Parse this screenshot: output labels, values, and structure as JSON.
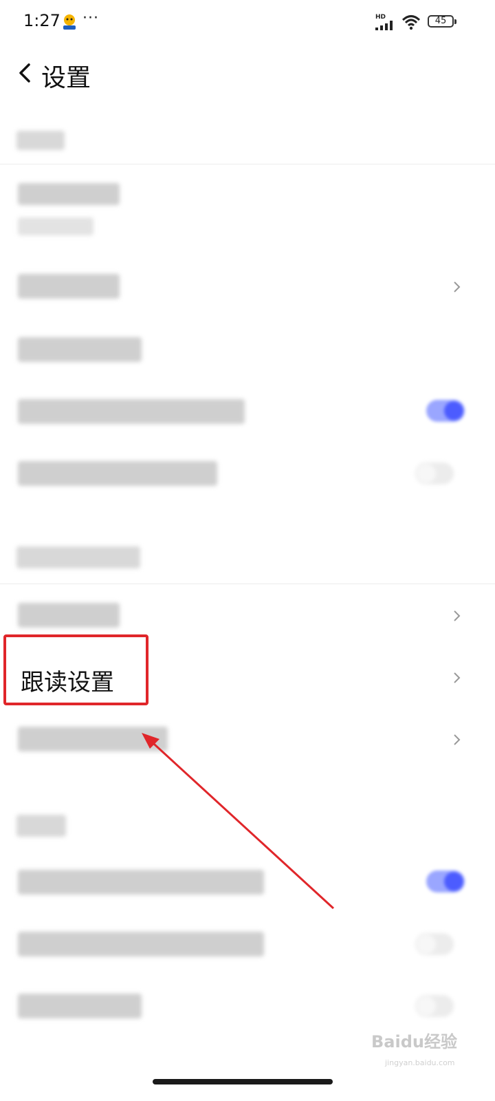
{
  "status_bar": {
    "time": "1:27",
    "more": "···",
    "network": "HD",
    "battery": "45"
  },
  "header": {
    "title": "设置"
  },
  "focus_item": {
    "label": "跟读设置"
  },
  "watermark": {
    "brand": "Baidu经验",
    "url": "jingyan.baidu.com"
  },
  "colors": {
    "accent": "#4c5cff",
    "highlight": "#e0262a",
    "divider": "#ececec"
  },
  "toggles": {
    "row4": true,
    "row5": false,
    "row9": true,
    "row10": false,
    "row11": false
  }
}
